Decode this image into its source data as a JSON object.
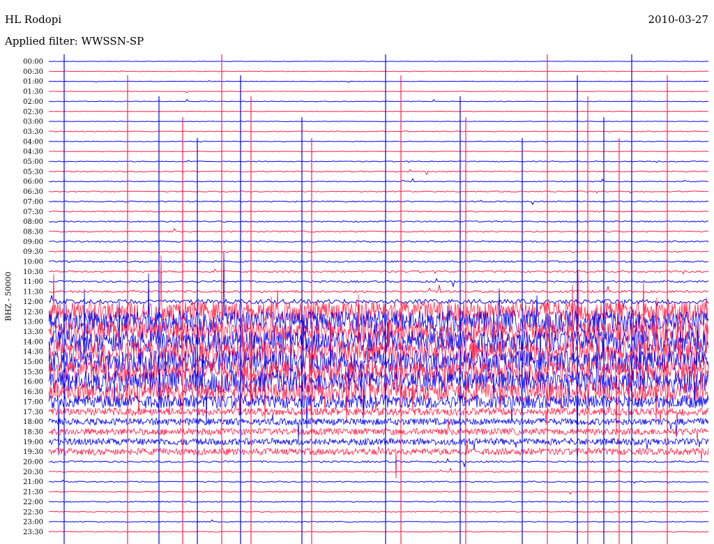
{
  "header": {
    "station": "HL Rodopi",
    "date": "2010-03-27",
    "filter": "Applied filter: WWSSN-SP"
  },
  "chart_data": {
    "type": "line",
    "title": "HL Rodopi",
    "ylabel": "BHZ - 50000",
    "row_labels": [
      "00:00",
      "00:30",
      "01:00",
      "01:30",
      "02:00",
      "02:30",
      "03:00",
      "03:30",
      "04:00",
      "04:30",
      "05:00",
      "05:30",
      "06:00",
      "06:30",
      "07:00",
      "07:30",
      "08:00",
      "08:30",
      "09:00",
      "09:30",
      "10:00",
      "10:30",
      "11:00",
      "11:30",
      "12:00",
      "12:30",
      "13:00",
      "13:30",
      "14:00",
      "14:30",
      "15:00",
      "15:30",
      "16:00",
      "16:30",
      "17:00",
      "17:30",
      "18:00",
      "18:30",
      "19:00",
      "19:30",
      "20:00",
      "20:30",
      "21:00",
      "21:30",
      "22:00",
      "22:30",
      "23:00",
      "23:30"
    ],
    "series_colors": [
      "#0000ee",
      "#ff1e46"
    ],
    "traces": [
      {
        "label": "00:00",
        "noise": 0.02
      },
      {
        "label": "00:30",
        "noise": 0.03
      },
      {
        "label": "01:00",
        "noise": 0.02
      },
      {
        "label": "01:30",
        "noise": 0.02
      },
      {
        "label": "02:00",
        "noise": 0.03
      },
      {
        "label": "02:30",
        "noise": 0.02
      },
      {
        "label": "03:00",
        "noise": 0.02
      },
      {
        "label": "03:30",
        "noise": 0.04
      },
      {
        "label": "04:00",
        "noise": 0.03
      },
      {
        "label": "04:30",
        "noise": 0.03
      },
      {
        "label": "05:00",
        "noise": 0.04
      },
      {
        "label": "05:30",
        "noise": 0.05
      },
      {
        "label": "06:00",
        "noise": 0.04
      },
      {
        "label": "06:30",
        "noise": 0.05
      },
      {
        "label": "07:00",
        "noise": 0.05
      },
      {
        "label": "07:30",
        "noise": 0.05
      },
      {
        "label": "08:00",
        "noise": 0.06
      },
      {
        "label": "08:30",
        "noise": 0.06
      },
      {
        "label": "09:00",
        "noise": 0.06
      },
      {
        "label": "09:30",
        "noise": 0.05
      },
      {
        "label": "10:00",
        "noise": 0.07
      },
      {
        "label": "10:30",
        "noise": 0.08
      },
      {
        "label": "11:00",
        "noise": 0.08
      },
      {
        "label": "11:30",
        "noise": 0.1
      },
      {
        "label": "12:00",
        "noise": 0.2
      },
      {
        "label": "12:30",
        "noise": 0.9
      },
      {
        "label": "13:00",
        "noise": 1.0
      },
      {
        "label": "13:30",
        "noise": 1.0
      },
      {
        "label": "14:00",
        "noise": 1.0
      },
      {
        "label": "14:30",
        "noise": 1.0
      },
      {
        "label": "15:00",
        "noise": 1.0
      },
      {
        "label": "15:30",
        "noise": 1.0
      },
      {
        "label": "16:00",
        "noise": 1.0
      },
      {
        "label": "16:30",
        "noise": 0.9
      },
      {
        "label": "17:00",
        "noise": 0.6
      },
      {
        "label": "17:30",
        "noise": 0.35
      },
      {
        "label": "18:00",
        "noise": 0.3
      },
      {
        "label": "18:30",
        "noise": 0.3
      },
      {
        "label": "19:00",
        "noise": 0.3
      },
      {
        "label": "19:30",
        "noise": 0.3
      },
      {
        "label": "20:00",
        "noise": 0.08
      },
      {
        "label": "20:30",
        "noise": 0.05
      },
      {
        "label": "21:00",
        "noise": 0.05
      },
      {
        "label": "21:30",
        "noise": 0.04
      },
      {
        "label": "22:00",
        "noise": 0.05
      },
      {
        "label": "22:30",
        "noise": 0.04
      },
      {
        "label": "23:00",
        "noise": 0.04
      },
      {
        "label": "23:30",
        "noise": 0.04
      }
    ]
  }
}
